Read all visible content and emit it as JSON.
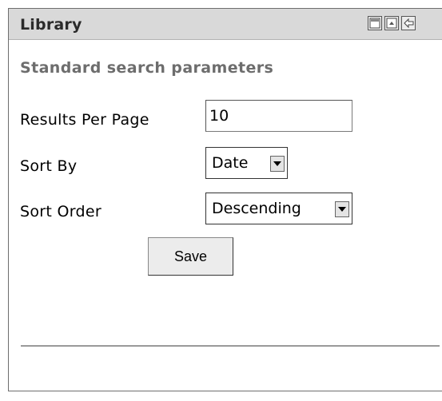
{
  "portlet": {
    "title": "Library",
    "controls": [
      {
        "name": "minimize-icon"
      },
      {
        "name": "maximize-icon"
      },
      {
        "name": "return-icon"
      }
    ]
  },
  "form": {
    "section_title": "Standard search parameters",
    "results_per_page": {
      "label": "Results Per Page",
      "value": "10"
    },
    "sort_by": {
      "label": "Sort By",
      "selected": "Date"
    },
    "sort_order": {
      "label": "Sort Order",
      "selected": "Descending"
    },
    "save_label": "Save"
  }
}
